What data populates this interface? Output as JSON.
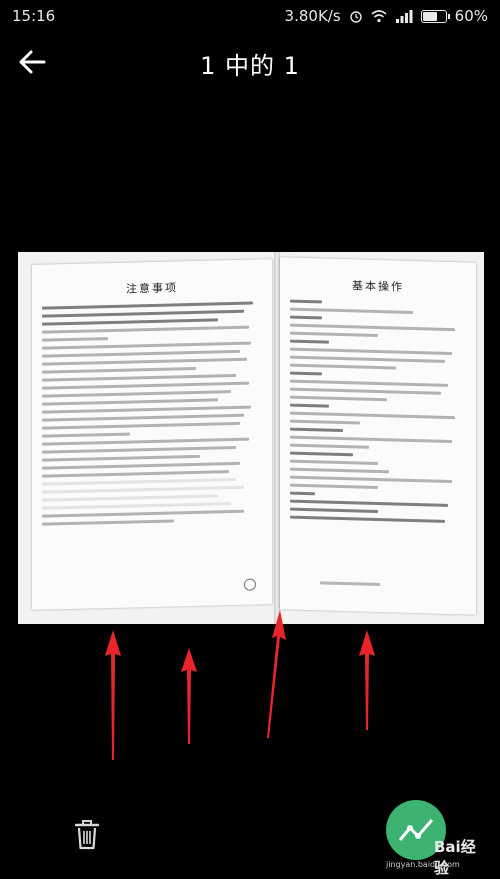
{
  "status_bar": {
    "time": "15:16",
    "network_speed": "3.80K/s",
    "battery": "60%",
    "icons": [
      "alarm-icon",
      "wifi-icon",
      "signal-icon",
      "battery-icon"
    ]
  },
  "header": {
    "title": "1 中的 1",
    "back_icon": "back-arrow-icon"
  },
  "photo": {
    "left_page_title": "注意事项",
    "right_page_title": "基本操作",
    "annotation_color": "#e8252a"
  },
  "toolbar": {
    "delete_icon": "trash-icon"
  },
  "watermark": {
    "brand": "Bai经验",
    "domain": "jingyan.baidu.com"
  }
}
